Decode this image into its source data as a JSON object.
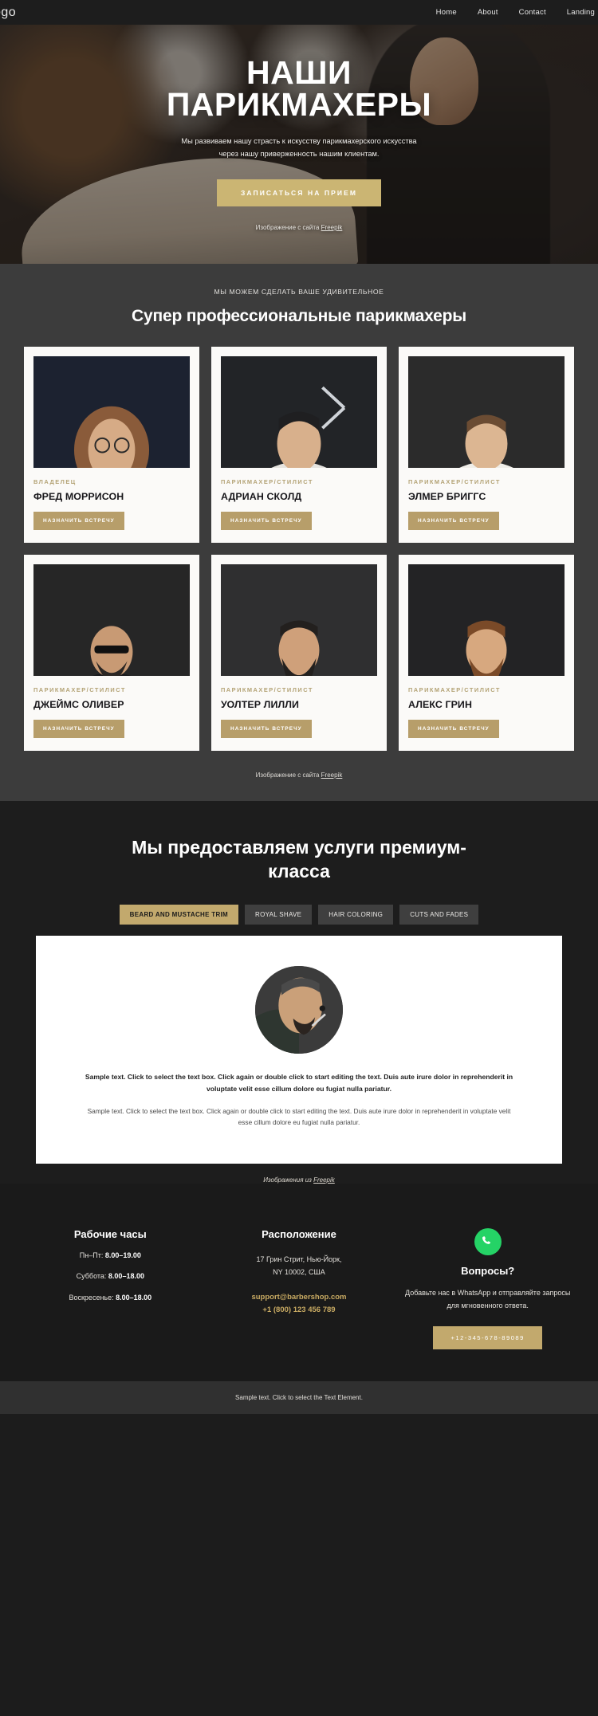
{
  "header": {
    "logo": "ogo",
    "nav": [
      {
        "label": "Home"
      },
      {
        "label": "About"
      },
      {
        "label": "Contact"
      },
      {
        "label": "Landing"
      }
    ]
  },
  "hero": {
    "title_line1": "НАШИ",
    "title_line2": "ПАРИКМАХЕРЫ",
    "subtitle": "Мы развиваем нашу страсть к искусству парикмахерского искусства через нашу приверженность нашим клиентам.",
    "cta_label": "ЗАПИСАТЬСЯ НА ПРИЕМ",
    "credit_prefix": "Изображение с сайта ",
    "credit_link": "Freepik"
  },
  "team": {
    "eyebrow": "МЫ МОЖЕМ СДЕЛАТЬ ВАШЕ УДИВИТЕЛЬНОЕ",
    "title": "Супер профессиональные парикмахеры",
    "credit_prefix": "Изображение с сайта ",
    "credit_link": "Freepik",
    "members": [
      {
        "role": "ВЛАДЕЛЕЦ",
        "name": "ФРЕД МОРРИСОН",
        "button": "НАЗНАЧИТЬ ВСТРЕЧУ"
      },
      {
        "role": "ПАРИКМАХЕР/СТИЛИСТ",
        "name": "АДРИАН СКОЛД",
        "button": "НАЗНАЧИТЬ ВСТРЕЧУ"
      },
      {
        "role": "ПАРИКМАХЕР/СТИЛИСТ",
        "name": "ЭЛМЕР БРИГГС",
        "button": "НАЗНАЧИТЬ ВСТРЕЧУ"
      },
      {
        "role": "ПАРИКМАХЕР/СТИЛИСТ",
        "name": "ДЖЕЙМС ОЛИВЕР",
        "button": "НАЗНАЧИТЬ ВСТРЕЧУ"
      },
      {
        "role": "ПАРИКМАХЕР/СТИЛИСТ",
        "name": "УОЛТЕР ЛИЛЛИ",
        "button": "НАЗНАЧИТЬ ВСТРЕЧУ"
      },
      {
        "role": "ПАРИКМАХЕР/СТИЛИСТ",
        "name": "АЛЕКС ГРИН",
        "button": "НАЗНАЧИТЬ ВСТРЕЧУ"
      }
    ]
  },
  "services": {
    "title": "Мы предоставляем услуги премиум-класса",
    "tabs": [
      {
        "label": "BEARD AND MUSTACHE TRIM",
        "active": true
      },
      {
        "label": "ROYAL SHAVE",
        "active": false
      },
      {
        "label": "HAIR COLORING",
        "active": false
      },
      {
        "label": "CUTS AND FADES",
        "active": false
      }
    ],
    "lead": "Sample text. Click to select the text box. Click again or double click to start editing the text. Duis aute irure dolor in reprehenderit in voluptate velit esse cillum dolore eu fugiat nulla pariatur.",
    "body": "Sample text. Click to select the text box. Click again or double click to start editing the text. Duis aute irure dolor in reprehenderit in voluptate velit esse cillum dolore eu fugiat nulla pariatur.",
    "credit_prefix": "Изображения из ",
    "credit_link": "Freepik"
  },
  "footer": {
    "hours": {
      "title": "Рабочие часы",
      "rows": [
        {
          "label": "Пн–Пт: ",
          "value": "8.00–19.00"
        },
        {
          "label": "Суббота: ",
          "value": "8.00–18.00"
        },
        {
          "label": "Воскресенье: ",
          "value": "8.00–18.00"
        }
      ]
    },
    "location": {
      "title": "Расположение",
      "address_line1": "17 Грин Стрит, Нью-Йорк,",
      "address_line2": "NY 10002, США",
      "email": "support@barbershop.com",
      "phone": "+1 (800) 123 456 789"
    },
    "questions": {
      "icon": "whatsapp-icon",
      "title": "Вопросы?",
      "text": "Добавьте нас в WhatsApp и отправляйте запросы для мгновенного ответа.",
      "button": "+12-345-678-89089"
    },
    "bottom_note": "Sample text. Click to select the Text Element."
  },
  "colors": {
    "accent": "#c2a96d",
    "accent_soft": "#b79e6a",
    "hero_cta": "#cbb573",
    "team_bg": "#3c3c3c",
    "dark_bg": "#1d1d1d",
    "whatsapp_green": "#25D366"
  }
}
